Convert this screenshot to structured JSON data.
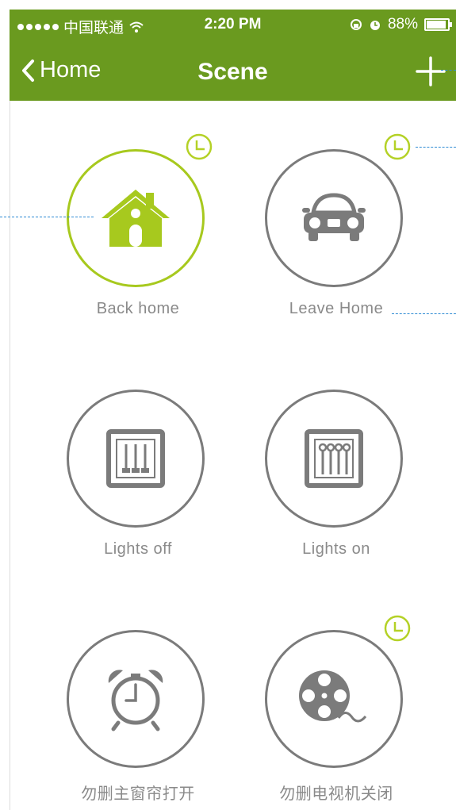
{
  "status": {
    "carrier": "中国联通",
    "time": "2:20 PM",
    "battery": "88%"
  },
  "nav": {
    "back_label": "Home",
    "title": "Scene"
  },
  "scenes": [
    {
      "label": "Back home",
      "icon": "house-icon",
      "active": true,
      "scheduled": true
    },
    {
      "label": "Leave Home",
      "icon": "car-icon",
      "active": false,
      "scheduled": true
    },
    {
      "label": "Lights off",
      "icon": "sliders-down-icon",
      "active": false,
      "scheduled": false
    },
    {
      "label": "Lights on",
      "icon": "sliders-up-icon",
      "active": false,
      "scheduled": false
    },
    {
      "label": "勿删主窗帘打开",
      "icon": "alarm-clock-icon",
      "active": false,
      "scheduled": false
    },
    {
      "label": "勿删电视机关闭",
      "icon": "film-reel-icon",
      "active": false,
      "scheduled": true
    }
  ],
  "colors": {
    "accent": "#6a9a1f",
    "active_ring": "#a7c91e",
    "icon_gray": "#7b7b7b",
    "label_gray": "#8a8a8a",
    "guide": "#2e8bd3"
  }
}
